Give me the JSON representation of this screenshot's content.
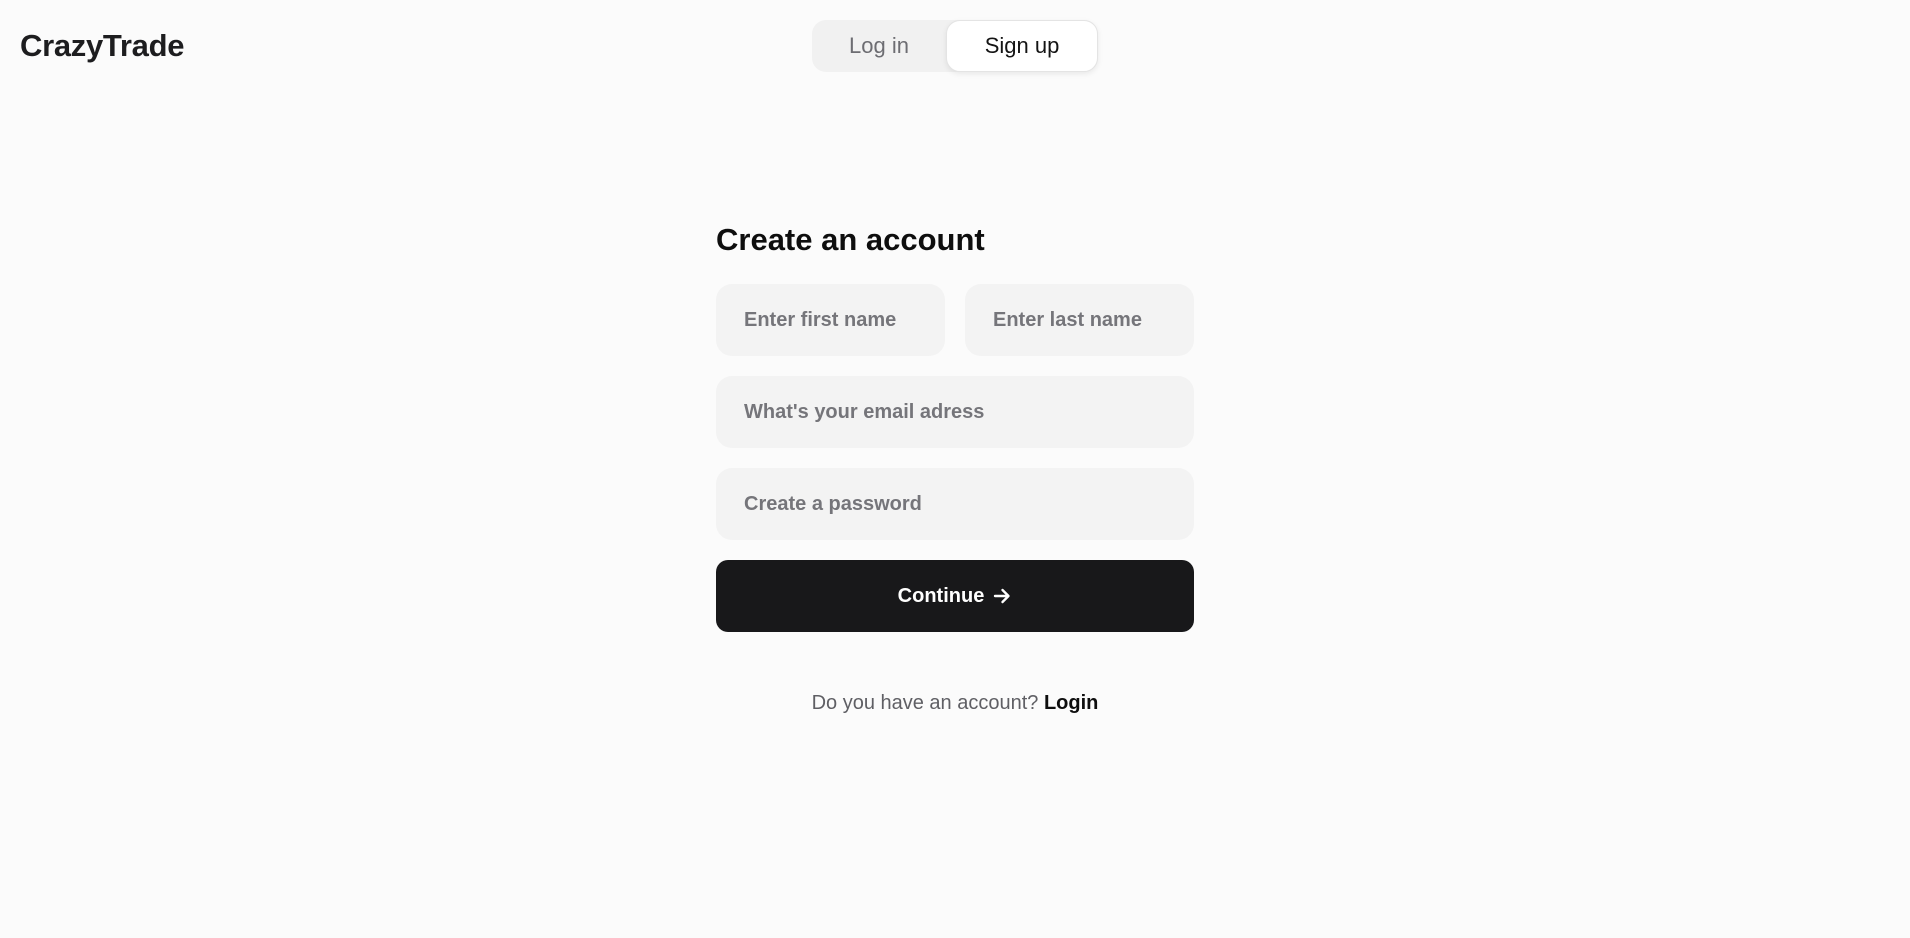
{
  "header": {
    "logo_text": "CrazyTrade",
    "toggle": {
      "login_label": "Log in",
      "signup_label": "Sign up",
      "active": "signup"
    }
  },
  "form": {
    "title": "Create an account",
    "first_name_placeholder": "Enter first name",
    "last_name_placeholder": "Enter last name",
    "email_placeholder": "What's your email adress",
    "password_placeholder": "Create a password",
    "continue_label": "Continue",
    "continue_icon": "arrow-right-icon"
  },
  "footer": {
    "prompt_text": "Do you have an account?",
    "login_link_label": "Login"
  },
  "colors": {
    "background": "#fbfbfb",
    "input_bg": "#f3f3f3",
    "button_bg": "#18181a",
    "button_text": "#ffffff"
  }
}
